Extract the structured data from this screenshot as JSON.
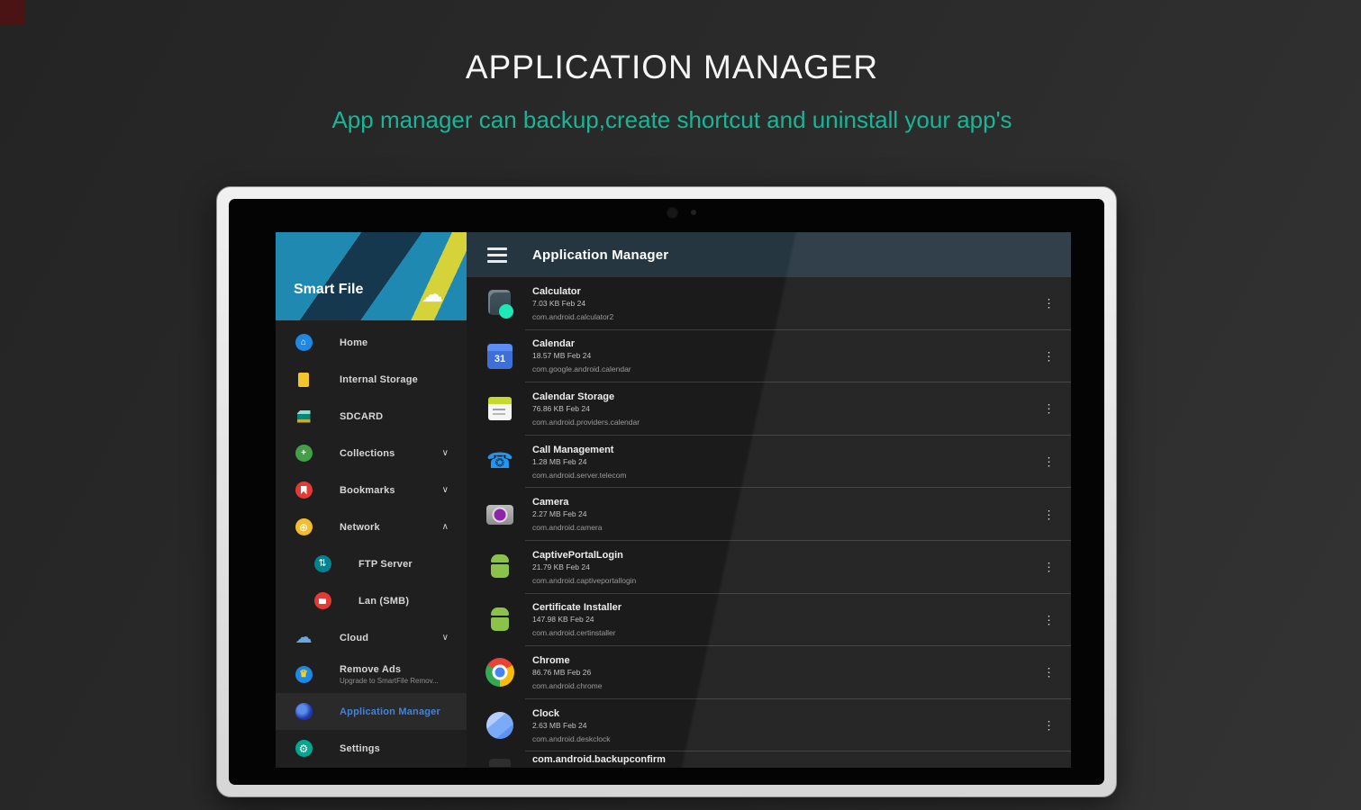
{
  "page": {
    "title": "APPLICATION MANAGER",
    "subtitle": "App manager can backup,create shortcut and uninstall your app's"
  },
  "colors": {
    "accent_teal": "#18b597",
    "drawer_teal": "#2089b1",
    "drawer_navy": "#16384f",
    "drawer_yellow": "#d6d23a",
    "appbar_slate": "#263641",
    "active_item_blue": "#3f83e0"
  },
  "icons": {
    "brand_cloud": "☁",
    "home": "⌂",
    "collections_glyph": "+",
    "network_glyph": "⊕",
    "ftp_glyph": "⇅",
    "cloud": "☁",
    "crown": "♛",
    "gear": "⚙",
    "phone": "☎",
    "calendar_day": "31",
    "chevron_down": "∨",
    "chevron_up": "∧",
    "kebab": "⋮"
  },
  "app": {
    "brand": "Smart File",
    "header": {
      "title": "Application Manager"
    },
    "sidebar": {
      "items": [
        {
          "label": "Home"
        },
        {
          "label": "Internal Storage"
        },
        {
          "label": "SDCARD"
        },
        {
          "label": "Collections"
        },
        {
          "label": "Bookmarks"
        },
        {
          "label": "Network"
        },
        {
          "label": "FTP Server"
        },
        {
          "label": "Lan (SMB)"
        },
        {
          "label": "Cloud"
        },
        {
          "label": "Remove Ads",
          "sublabel": "Upgrade to SmartFile Remov..."
        },
        {
          "label": "Application Manager"
        },
        {
          "label": "Settings"
        }
      ]
    },
    "apps": [
      {
        "name": "Calculator",
        "size_date": "7.03 KB Feb 24",
        "package": "com.android.calculator2"
      },
      {
        "name": "Calendar",
        "size_date": "18.57 MB Feb 24",
        "package": "com.google.android.calendar"
      },
      {
        "name": "Calendar Storage",
        "size_date": "76.86 KB Feb 24",
        "package": "com.android.providers.calendar"
      },
      {
        "name": "Call Management",
        "size_date": "1.28 MB Feb 24",
        "package": "com.android.server.telecom"
      },
      {
        "name": "Camera",
        "size_date": "2.27 MB Feb 24",
        "package": "com.android.camera"
      },
      {
        "name": "CaptivePortalLogin",
        "size_date": "21.79 KB Feb 24",
        "package": "com.android.captiveportallogin"
      },
      {
        "name": "Certificate Installer",
        "size_date": "147.98 KB Feb 24",
        "package": "com.android.certinstaller"
      },
      {
        "name": "Chrome",
        "size_date": "86.76 MB Feb 26",
        "package": "com.android.chrome"
      },
      {
        "name": "Clock",
        "size_date": "2.63 MB Feb 24",
        "package": "com.android.deskclock"
      }
    ],
    "partial_app": "com.android.backupconfirm"
  }
}
